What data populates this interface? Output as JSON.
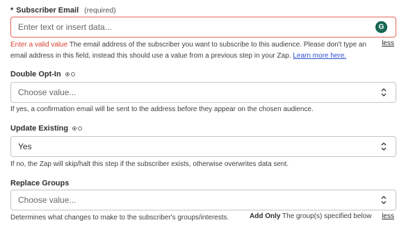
{
  "subscriber_email": {
    "star": "*",
    "label": "Subscriber Email",
    "required": "(required)",
    "placeholder": "Enter text or insert data...",
    "error_text": "Enter a valid value",
    "help_text": " The email address of the subscriber you want to subscribe to this audience. Please don't type an email address in this field, instead this should use a value from a previous step in your Zap. ",
    "learn_more": "Learn more here.",
    "less": "less",
    "extension_icon": "G"
  },
  "double_opt_in": {
    "label": "Double Opt-In",
    "placeholder": "Choose value...",
    "help_text": "If yes, a confirmation email will be sent to the address before they appear on the chosen audience."
  },
  "update_existing": {
    "label": "Update Existing",
    "value": "Yes",
    "help_text": "If no, the Zap will skip/halt this step if the subscriber exists, otherwise overwrites data sent."
  },
  "replace_groups": {
    "label": "Replace Groups",
    "placeholder": "Choose value...",
    "help_text": "Determines what changes to make to the subscriber's groups/interests.",
    "option_name": "Add Only",
    "option_desc": " The group(s) specified below",
    "less": "less"
  }
}
